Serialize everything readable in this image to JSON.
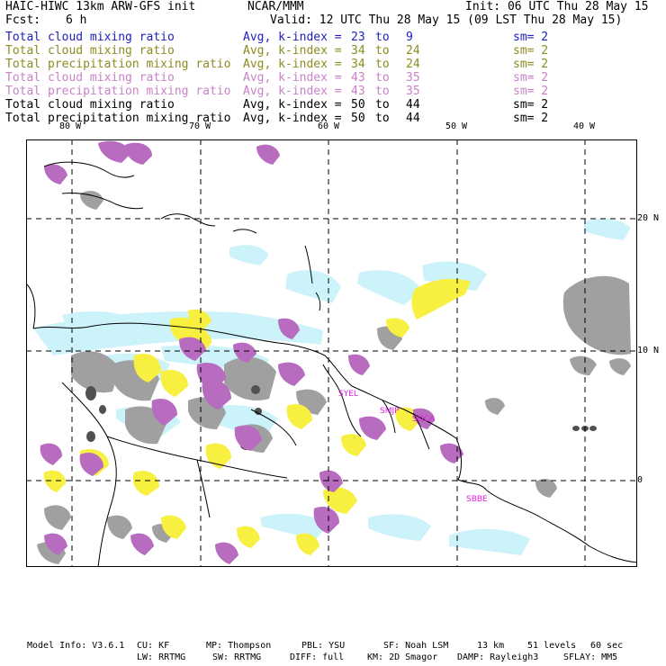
{
  "header": {
    "model_title": "HAIC-HIWC 13km ARW-GFS init",
    "org": "NCAR/MMM",
    "init": "Init: 06 UTC Thu 28 May 15",
    "fcst_label": "Fcst:",
    "fcst_value": "6 h",
    "valid": "Valid: 12 UTC Thu 28 May 15 (09 LST Thu 28 May 15)"
  },
  "fields": [
    {
      "name": "Total cloud mixing ratio",
      "avg": "Avg, k-index =",
      "from": "23",
      "to_word": "to",
      "to": "9",
      "sm": "sm= 2",
      "color": "#2020c0"
    },
    {
      "name": "Total cloud mixing ratio",
      "avg": "Avg, k-index =",
      "from": "34",
      "to_word": "to",
      "to": "24",
      "sm": "sm= 2",
      "color": "#8c8c20"
    },
    {
      "name": "Total precipitation mixing ratio",
      "avg": "Avg, k-index =",
      "from": "34",
      "to_word": "to",
      "to": "24",
      "sm": "sm= 2",
      "color": "#8c8c20"
    },
    {
      "name": "Total cloud mixing ratio",
      "avg": "Avg, k-index =",
      "from": "43",
      "to_word": "to",
      "to": "35",
      "sm": "sm= 2",
      "color": "#c882c8"
    },
    {
      "name": "Total precipitation mixing ratio",
      "avg": "Avg, k-index =",
      "from": "43",
      "to_word": "to",
      "to": "35",
      "sm": "sm= 2",
      "color": "#c882c8"
    },
    {
      "name": "Total cloud mixing ratio",
      "avg": "Avg, k-index =",
      "from": "50",
      "to_word": "to",
      "to": "44",
      "sm": "sm= 2",
      "color": "#000000"
    },
    {
      "name": "Total precipitation mixing ratio",
      "avg": "Avg, k-index =",
      "from": "50",
      "to_word": "to",
      "to": "44",
      "sm": "sm= 2",
      "color": "#000000"
    }
  ],
  "map": {
    "lon_labels": [
      "80 W",
      "70 W",
      "60 W",
      "50 W",
      "40 W"
    ],
    "lat_labels": [
      "20 N",
      "10 N",
      "0"
    ],
    "stations": [
      "SYEL",
      "SMJP",
      "SOCA",
      "SBBE"
    ],
    "colors": {
      "light_cyan": "#ccf2fa",
      "yellow": "#f8f040",
      "purple": "#b86cc0",
      "gray": "#a0a0a0",
      "dark_gray": "#505050",
      "station": "#e020e0"
    }
  },
  "footer": {
    "line1": [
      "Model Info: V3.6.1",
      "CU: KF",
      "MP: Thompson",
      "PBL: YSU",
      "SF: Noah LSM",
      "13 km",
      "51 levels",
      "60 sec"
    ],
    "line2": [
      "LW: RRTMG",
      "SW: RRTMG",
      "DIFF: full",
      "KM: 2D Smagor",
      "DAMP: Rayleigh3",
      "SFLAY: MM5"
    ]
  }
}
